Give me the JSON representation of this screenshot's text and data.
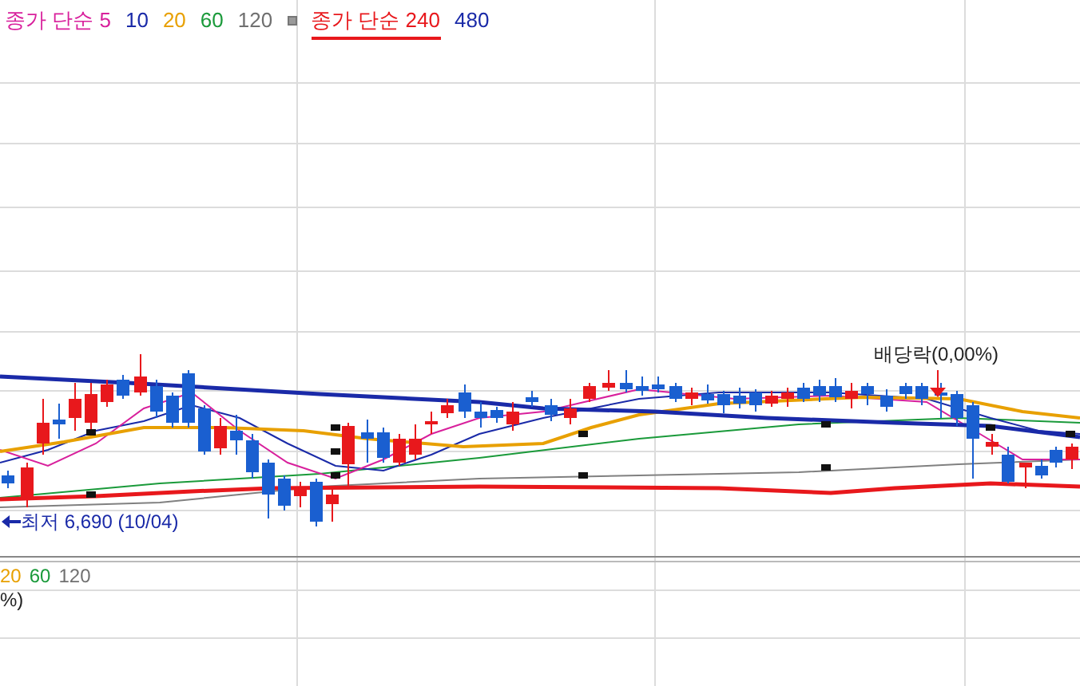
{
  "legend": [
    {
      "label": "종가 단순 5",
      "color": "#d8209c",
      "selected": false,
      "kind": "text"
    },
    {
      "label": "10",
      "color": "#1a2aa8",
      "selected": false,
      "kind": "text"
    },
    {
      "label": "20",
      "color": "#e8a000",
      "selected": false,
      "kind": "text"
    },
    {
      "label": "60",
      "color": "#1a9a3a",
      "selected": false,
      "kind": "text"
    },
    {
      "label": "120",
      "color": "#707070",
      "selected": false,
      "kind": "text"
    },
    {
      "kind": "marker"
    },
    {
      "label": "종가 단순 240",
      "color": "#e8181c",
      "selected": true,
      "kind": "text"
    },
    {
      "label": "480",
      "color": "#1a2aa8",
      "selected": false,
      "kind": "text"
    }
  ],
  "annotations": {
    "dividend": "배당락(0,00%)",
    "low": "최저 6,690 (10/04)"
  },
  "lower_panel": {
    "legend": [
      {
        "label": "20",
        "color": "#e8a000"
      },
      {
        "label": "60",
        "color": "#1a9a3a"
      },
      {
        "label": "120",
        "color": "#707070"
      }
    ],
    "label": "%)"
  }
}
